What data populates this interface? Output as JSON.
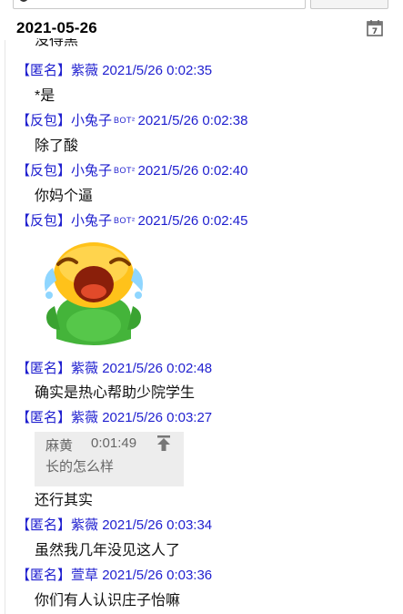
{
  "date_header": "2021-05-26",
  "truncated_top_message": "没得黑",
  "messages": [
    {
      "tag": "【匿名】",
      "name": "紫薇",
      "bot": "",
      "time": "2021/5/26 0:02:35",
      "text": "*是"
    },
    {
      "tag": "【反包】",
      "name": "小兔子",
      "bot": "BOT²",
      "time": "2021/5/26 0:02:38",
      "text": "除了酸"
    },
    {
      "tag": "【反包】",
      "name": "小兔子",
      "bot": "BOT²",
      "time": "2021/5/26 0:02:40",
      "text": "你妈个逼"
    },
    {
      "tag": "【反包】",
      "name": "小兔子",
      "bot": "BOT²",
      "time": "2021/5/26 0:02:45",
      "text": ""
    },
    {
      "tag": "【匿名】",
      "name": "紫薇",
      "bot": "",
      "time": "2021/5/26 0:02:48",
      "text": "确实是热心帮助少院学生"
    },
    {
      "tag": "【匿名】",
      "name": "紫薇",
      "bot": "",
      "time": "2021/5/26 0:03:27",
      "text": "还行其实"
    },
    {
      "tag": "【匿名】",
      "name": "紫薇",
      "bot": "",
      "time": "2021/5/26 0:03:34",
      "text": "虽然我几年没见这人了"
    },
    {
      "tag": "【匿名】",
      "name": "萱草",
      "bot": "",
      "time": "2021/5/26 0:03:36",
      "text": "你们有人认识庄子怡嘛"
    }
  ],
  "quote": {
    "author": "麻黄",
    "time": "0:01:49",
    "text": "长的怎么样"
  },
  "colors": {
    "meta": "#1f1fcf",
    "quote_bg": "#ededed",
    "quote_text": "#666666"
  }
}
